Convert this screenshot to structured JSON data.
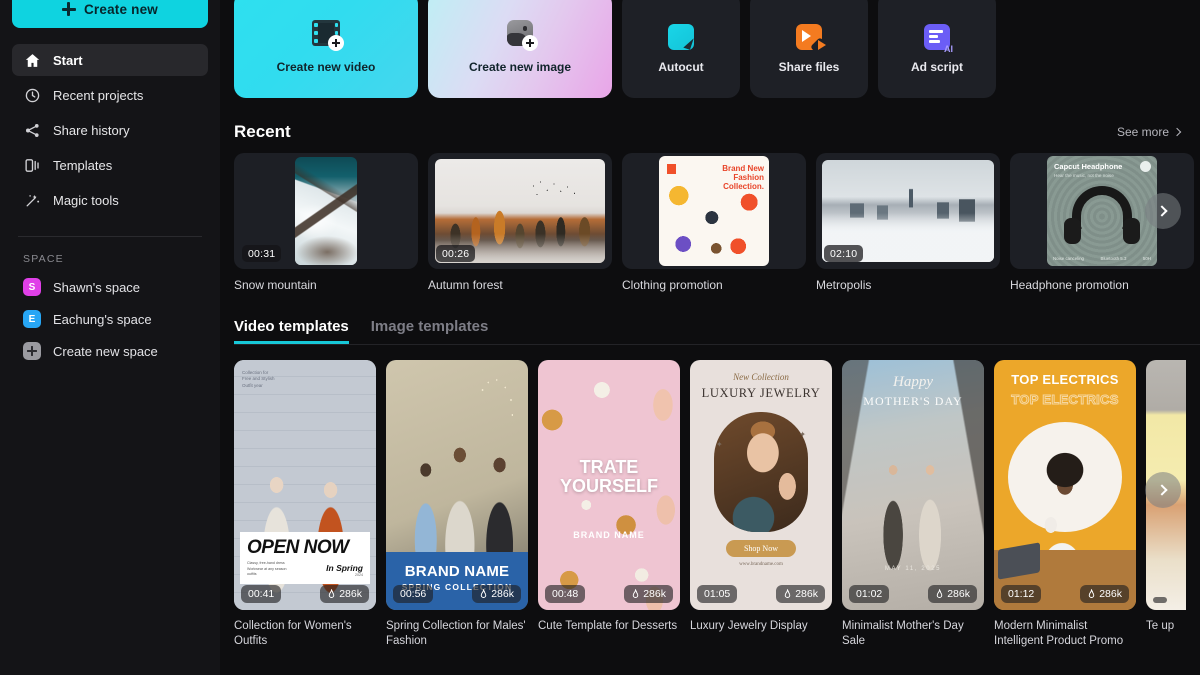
{
  "sidebar": {
    "create_new": {
      "label": "Create new",
      "icon": "plus-icon",
      "color": "#0fd3e0"
    },
    "nav_items": [
      {
        "label": "Start",
        "icon": "home-icon",
        "active": true
      },
      {
        "label": "Recent projects",
        "icon": "clock-icon",
        "active": false
      },
      {
        "label": "Share history",
        "icon": "share-icon",
        "active": false
      },
      {
        "label": "Templates",
        "icon": "templates-icon",
        "active": false
      },
      {
        "label": "Magic tools",
        "icon": "magic-wand-icon",
        "active": false
      }
    ],
    "space_header": "SPACE",
    "spaces": [
      {
        "label": "Shawn's space",
        "initial": "S",
        "color": "#e040e8"
      },
      {
        "label": "Eachung's space",
        "initial": "E",
        "color": "#27a6f5"
      },
      {
        "label": "Create new space",
        "initial": "+",
        "color": "#9a9aa0"
      }
    ]
  },
  "quick_actions": [
    {
      "label": "Create new video",
      "icon": "film-plus-icon",
      "style": "gradient-cyan"
    },
    {
      "label": "Create new image",
      "icon": "image-plus-icon",
      "style": "gradient-pink"
    },
    {
      "label": "Autocut",
      "icon": "autocut-icon",
      "style": "dark",
      "accent": "#19d6e8"
    },
    {
      "label": "Share files",
      "icon": "share-files-icon",
      "style": "dark",
      "accent": "#f47b20"
    },
    {
      "label": "Ad script",
      "icon": "ad-script-ai-icon",
      "style": "dark",
      "accent": "#6b5df6"
    }
  ],
  "recent": {
    "title": "Recent",
    "see_more": "See more",
    "items": [
      {
        "name": "Snow mountain",
        "duration": "00:31",
        "orientation": "portrait"
      },
      {
        "name": "Autumn forest",
        "duration": "00:26",
        "orientation": "landscape"
      },
      {
        "name": "Clothing promotion",
        "duration": "",
        "orientation": "square"
      },
      {
        "name": "Metropolis",
        "duration": "02:10",
        "orientation": "landscape"
      },
      {
        "name": "Headphone promotion",
        "duration": "",
        "orientation": "square"
      }
    ],
    "next_label": "Next"
  },
  "templates": {
    "tabs": [
      {
        "label": "Video templates",
        "active": true
      },
      {
        "label": "Image templates",
        "active": false
      }
    ],
    "items": [
      {
        "name": "Collection for Women's Outfits",
        "duration": "00:41",
        "uses": "286k",
        "overlay_title": "OPEN NOW",
        "overlay_sub": "In Spring"
      },
      {
        "name": "Spring Collection for Males' Fashion",
        "duration": "00:56",
        "uses": "286k",
        "overlay_title": "BRAND NAME",
        "overlay_sub": "SPRING COLLECTION"
      },
      {
        "name": "Cute Template for Desserts",
        "duration": "00:48",
        "uses": "286k",
        "overlay_title": "TRATE YOURSELF",
        "overlay_sub": "BRAND NAME"
      },
      {
        "name": "Luxury Jewelry Display",
        "duration": "01:05",
        "uses": "286k",
        "overlay_title": "LUXURY JEWELRY",
        "overlay_sub": "New Collection",
        "cta": "Shop Now"
      },
      {
        "name": "Minimalist Mother's Day Sale",
        "duration": "01:02",
        "uses": "286k",
        "overlay_title": "MOTHER'S DAY",
        "overlay_sub": "Happy",
        "date": "MAY 11, 2025"
      },
      {
        "name": "Modern Minimalist Intelligent Product Promo",
        "duration": "01:12",
        "uses": "286k",
        "overlay_title": "TOP ELECTRICS",
        "overlay_sub": "TOP ELECTRICS"
      },
      {
        "name": "Te up",
        "duration": "",
        "uses": "",
        "overlay_title": "",
        "overlay_sub": ""
      }
    ],
    "next_label": "Next"
  },
  "card_thumb_text": {
    "clothing": {
      "line1": "Brand New",
      "line2": "Fashion",
      "line3": "Collection."
    },
    "headphone": {
      "title": "Capcut Headphone",
      "sub": "Hear the music, not the noise",
      "f1": "Noise canceling",
      "f2": "Bluetooth 5.3",
      "f3": "50H"
    }
  }
}
